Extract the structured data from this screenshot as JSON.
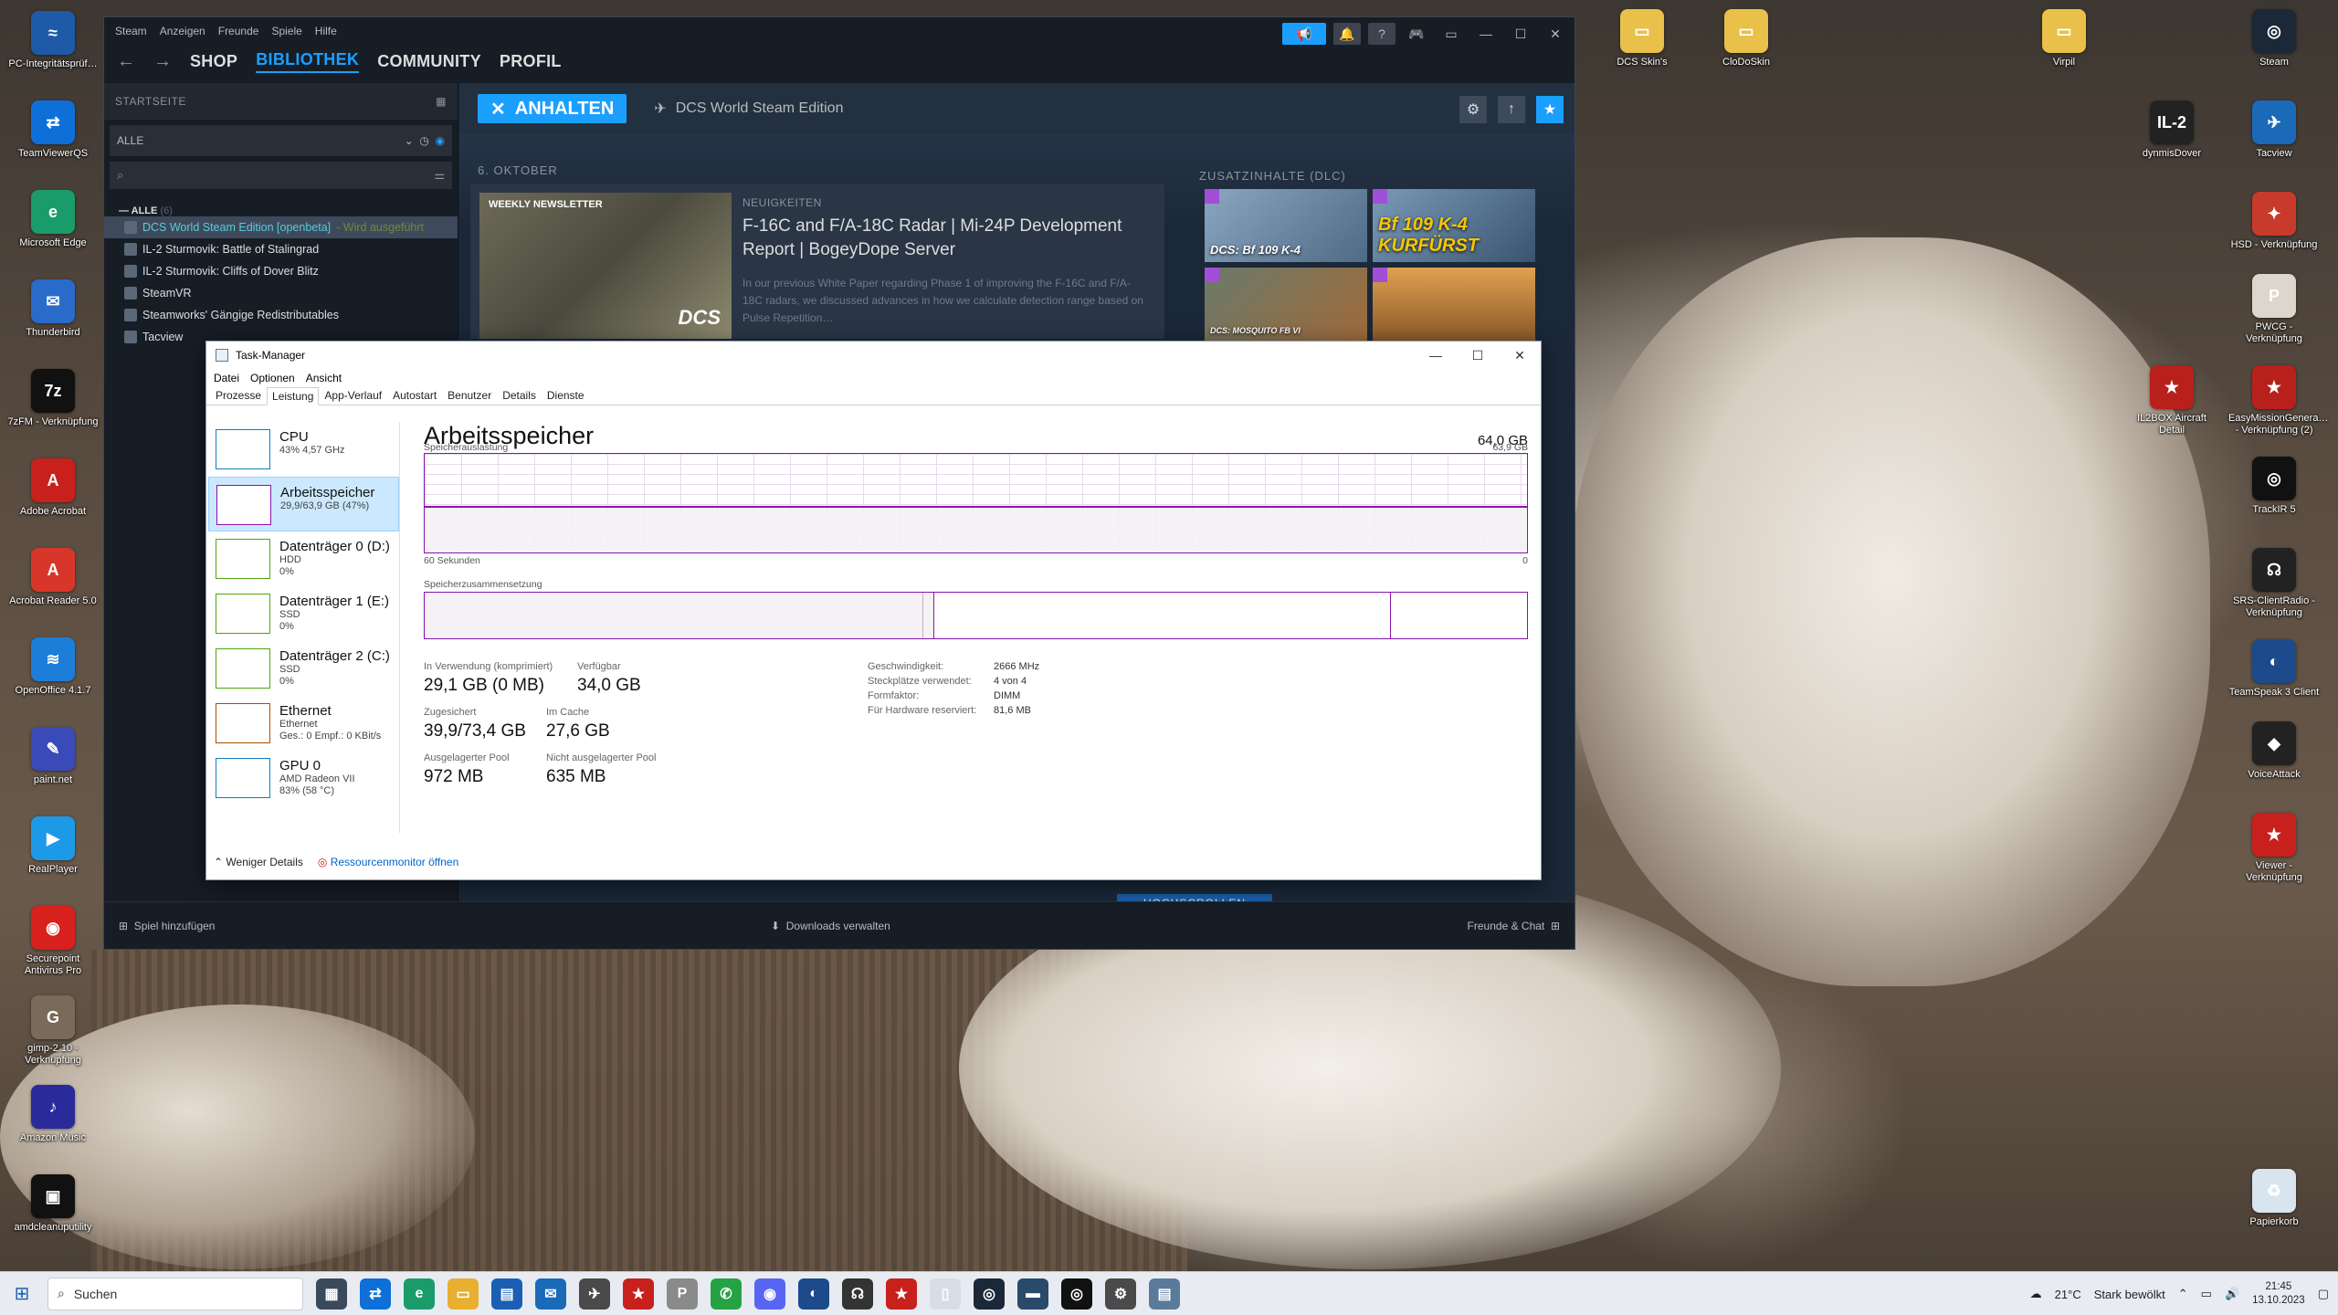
{
  "desktop_left_icons": [
    {
      "label": "PC-Integritätsprüf…",
      "color": "#1e5aa8",
      "glyph": "≈"
    },
    {
      "label": "TeamViewerQS",
      "color": "#0e6fd8",
      "glyph": "⇄"
    },
    {
      "label": "Microsoft Edge",
      "color": "#1a9c6a",
      "glyph": "e"
    },
    {
      "label": "Thunderbird",
      "color": "#2a6ac8",
      "glyph": "✉"
    },
    {
      "label": "7zFM - Verknüpfung",
      "color": "#111111",
      "glyph": "7z"
    },
    {
      "label": "Adobe Acrobat",
      "color": "#c8201c",
      "glyph": "A"
    },
    {
      "label": "Acrobat Reader 5.0",
      "color": "#d8362a",
      "glyph": "A"
    },
    {
      "label": "OpenOffice 4.1.7",
      "color": "#1c7ed8",
      "glyph": "≋"
    },
    {
      "label": "paint.net",
      "color": "#3a4ab8",
      "glyph": "✎"
    },
    {
      "label": "RealPlayer",
      "color": "#1c9ae8",
      "glyph": "▶"
    },
    {
      "label": "Securepoint Antivirus Pro",
      "color": "#d8201c",
      "glyph": "◉"
    },
    {
      "label": "gimp-2.10 - Verknüpfung",
      "color": "#7a6a5a",
      "glyph": "G"
    },
    {
      "label": "Amazon Music",
      "color": "#2a2a9a",
      "glyph": "♪"
    },
    {
      "label": "amdcleanuputility",
      "color": "#111111",
      "glyph": "▣"
    }
  ],
  "desktop_top_icons": [
    {
      "label": "DCS Skin's",
      "color": "#e8c04a",
      "glyph": "▭"
    },
    {
      "label": "CloDoSkin",
      "color": "#e8c04a",
      "glyph": "▭"
    },
    {
      "label": "Virpil",
      "color": "#e8c04a",
      "glyph": "▭"
    }
  ],
  "desktop_right_icons": [
    {
      "label": "Steam",
      "color": "#1b2838",
      "glyph": "◎"
    },
    {
      "label": "dynmisDover",
      "color": "#222222",
      "glyph": "IL-2"
    },
    {
      "label": "Tacview",
      "color": "#1a6ab8",
      "glyph": "✈"
    },
    {
      "label": "HSD - Verknüpfung",
      "color": "#c83a2a",
      "glyph": "✦"
    },
    {
      "label": "PWCG - Verknüpfung",
      "color": "#ddd6cc",
      "glyph": "P"
    },
    {
      "label": "IL2BOX Aircraft Detail",
      "color": "#b8201c",
      "glyph": "★"
    },
    {
      "label": "EasyMissionGenera… - Verknüpfung (2)",
      "color": "#b8201c",
      "glyph": "★"
    },
    {
      "label": "TrackIR 5",
      "color": "#111111",
      "glyph": "◎"
    },
    {
      "label": "SRS-ClientRadio - Verknüpfung",
      "color": "#222222",
      "glyph": "☊"
    },
    {
      "label": "TeamSpeak 3 Client",
      "color": "#1c4a8a",
      "glyph": "◐"
    },
    {
      "label": "VoiceAttack",
      "color": "#222222",
      "glyph": "◆"
    },
    {
      "label": "Viewer - Verknüpfung",
      "color": "#c8201c",
      "glyph": "★"
    },
    {
      "label": "Papierkorb",
      "color": "#d8e4ee",
      "glyph": "♻"
    }
  ],
  "steam": {
    "menu": [
      "Steam",
      "Anzeigen",
      "Freunde",
      "Spiele",
      "Hilfe"
    ],
    "nav": [
      "SHOP",
      "BIBLIOTHEK",
      "COMMUNITY",
      "PROFIL"
    ],
    "home_label": "STARTSEITE",
    "filter_label": "ALLE",
    "all_label": "— ALLE",
    "all_count": "(6)",
    "games": [
      {
        "name": "DCS World Steam Edition [openbeta]",
        "status": " - Wird ausgeführt",
        "selected": true
      },
      {
        "name": "IL-2 Sturmovik: Battle of Stalingrad",
        "status": "",
        "selected": false
      },
      {
        "name": "IL-2 Sturmovik: Cliffs of Dover Blitz",
        "status": "",
        "selected": false
      },
      {
        "name": "SteamVR",
        "status": "",
        "selected": false
      },
      {
        "name": "Steamworks' Gängige Redistributables",
        "status": "",
        "selected": false
      },
      {
        "name": "Tacview",
        "status": "",
        "selected": false
      }
    ],
    "play_button": "ANHALTEN",
    "game_title": "DCS World Steam Edition",
    "news_date": "6. OKTOBER",
    "news_newsletter": "WEEKLY NEWSLETTER",
    "news_logo": "DCS",
    "news_kind": "NEUIGKEITEN",
    "news_title": "F-16C and F/A-18C Radar | Mi-24P Development Report | BogeyDope Server",
    "news_body": "In our previous White Paper regarding Phase 1 of improving the F-16C and F/A-18C radars, we discussed advances in how we calculate detection range based on Pulse Repetition…",
    "dlc_title": "ZUSATZINHALTE (DLC)",
    "dlc": [
      "DCS: Bf 109 K-4",
      "Bf 109 K-4 KURFÜRST",
      "DCS: MOSQUITO FB VI",
      ""
    ],
    "scroll_up": "HOCHSCROLLEN",
    "add_game": "Spiel hinzufügen",
    "downloads": "Downloads verwalten",
    "friends": "Freunde & Chat"
  },
  "taskmanager": {
    "title": "Task-Manager",
    "menu": [
      "Datei",
      "Optionen",
      "Ansicht"
    ],
    "tabs": [
      "Prozesse",
      "Leistung",
      "App-Verlauf",
      "Autostart",
      "Benutzer",
      "Details",
      "Dienste"
    ],
    "active_tab": "Leistung",
    "items": [
      {
        "name": "CPU",
        "sub1": "43% 4,57 GHz",
        "sub2": "",
        "sub3": "",
        "kind": "cpu"
      },
      {
        "name": "Arbeitsspeicher",
        "sub1": "29,9/63,9 GB (47%)",
        "sub2": "",
        "sub3": "",
        "kind": "mem",
        "selected": true
      },
      {
        "name": "Datenträger 0 (D:)",
        "sub1": "HDD",
        "sub2": "0%",
        "sub3": "",
        "kind": "disk"
      },
      {
        "name": "Datenträger 1 (E:)",
        "sub1": "SSD",
        "sub2": "0%",
        "sub3": "",
        "kind": "disk"
      },
      {
        "name": "Datenträger 2 (C:)",
        "sub1": "SSD",
        "sub2": "0%",
        "sub3": "",
        "kind": "disk"
      },
      {
        "name": "Ethernet",
        "sub1": "Ethernet",
        "sub2": "Ges.: 0 Empf.: 0 KBit/s",
        "sub3": "",
        "kind": "eth"
      },
      {
        "name": "GPU 0",
        "sub1": "AMD Radeon VII",
        "sub2": "83% (58 °C)",
        "sub3": "",
        "kind": "gpu"
      }
    ],
    "heading": "Arbeitsspeicher",
    "total": "64,0 GB",
    "usage_label": "Speicherauslastung",
    "usage_max": "63,9 GB",
    "usage_fraction": 0.47,
    "axis_left": "60 Sekunden",
    "axis_right": "0",
    "composition_label": "Speicherzusammensetzung",
    "stats": [
      {
        "k": "In Verwendung (komprimiert)",
        "v": "29,1 GB (0 MB)"
      },
      {
        "k": "Verfügbar",
        "v": "34,0 GB"
      },
      {
        "k": "Zugesichert",
        "v": "39,9/73,4 GB"
      },
      {
        "k": "Im Cache",
        "v": "27,6 GB"
      },
      {
        "k": "Ausgelagerter Pool",
        "v": "972 MB"
      },
      {
        "k": "Nicht ausgelagerter Pool",
        "v": "635 MB"
      }
    ],
    "specs": [
      {
        "k": "Geschwindigkeit:",
        "v": "2666 MHz"
      },
      {
        "k": "Steckplätze verwendet:",
        "v": "4 von 4"
      },
      {
        "k": "Formfaktor:",
        "v": "DIMM"
      },
      {
        "k": "Für Hardware reserviert:",
        "v": "81,6 MB"
      }
    ],
    "less_details": "Weniger Details",
    "resource_monitor": "Ressourcenmonitor öffnen"
  },
  "taskbar": {
    "search": "Suchen",
    "weather_temp": "21°C",
    "weather_text": "Stark bewölkt",
    "time": "21:45",
    "date": "13.10.2023",
    "apps": [
      {
        "name": "task-view",
        "color": "#3a4a5a",
        "glyph": "▦"
      },
      {
        "name": "teamviewer",
        "color": "#0e6fd8",
        "glyph": "⇄"
      },
      {
        "name": "edge",
        "color": "#1a9c6a",
        "glyph": "e"
      },
      {
        "name": "explorer",
        "color": "#e8b030",
        "glyph": "▭"
      },
      {
        "name": "store",
        "color": "#1a5fb4",
        "glyph": "▤"
      },
      {
        "name": "mail",
        "color": "#1a6ab8",
        "glyph": "✉"
      },
      {
        "name": "il2",
        "color": "#4a4a4a",
        "glyph": "✈"
      },
      {
        "name": "star",
        "color": "#c8201c",
        "glyph": "★"
      },
      {
        "name": "pwcg",
        "color": "#8a8a8a",
        "glyph": "P"
      },
      {
        "name": "whatsapp",
        "color": "#25a244",
        "glyph": "✆"
      },
      {
        "name": "discord",
        "color": "#5865f2",
        "glyph": "◉"
      },
      {
        "name": "teamspeak",
        "color": "#1c4a8a",
        "glyph": "◐"
      },
      {
        "name": "srs",
        "color": "#333333",
        "glyph": "☊"
      },
      {
        "name": "viewer",
        "color": "#c8201c",
        "glyph": "★"
      },
      {
        "name": "notepad",
        "color": "#d8dce4",
        "glyph": "▯"
      },
      {
        "name": "steam",
        "color": "#1b2838",
        "glyph": "◎"
      },
      {
        "name": "dcs",
        "color": "#2a4a6a",
        "glyph": "▬"
      },
      {
        "name": "trackir",
        "color": "#111111",
        "glyph": "◎"
      },
      {
        "name": "settings",
        "color": "#4a4a4a",
        "glyph": "⚙"
      },
      {
        "name": "taskmanager",
        "color": "#5a7a9a",
        "glyph": "▤"
      }
    ]
  }
}
